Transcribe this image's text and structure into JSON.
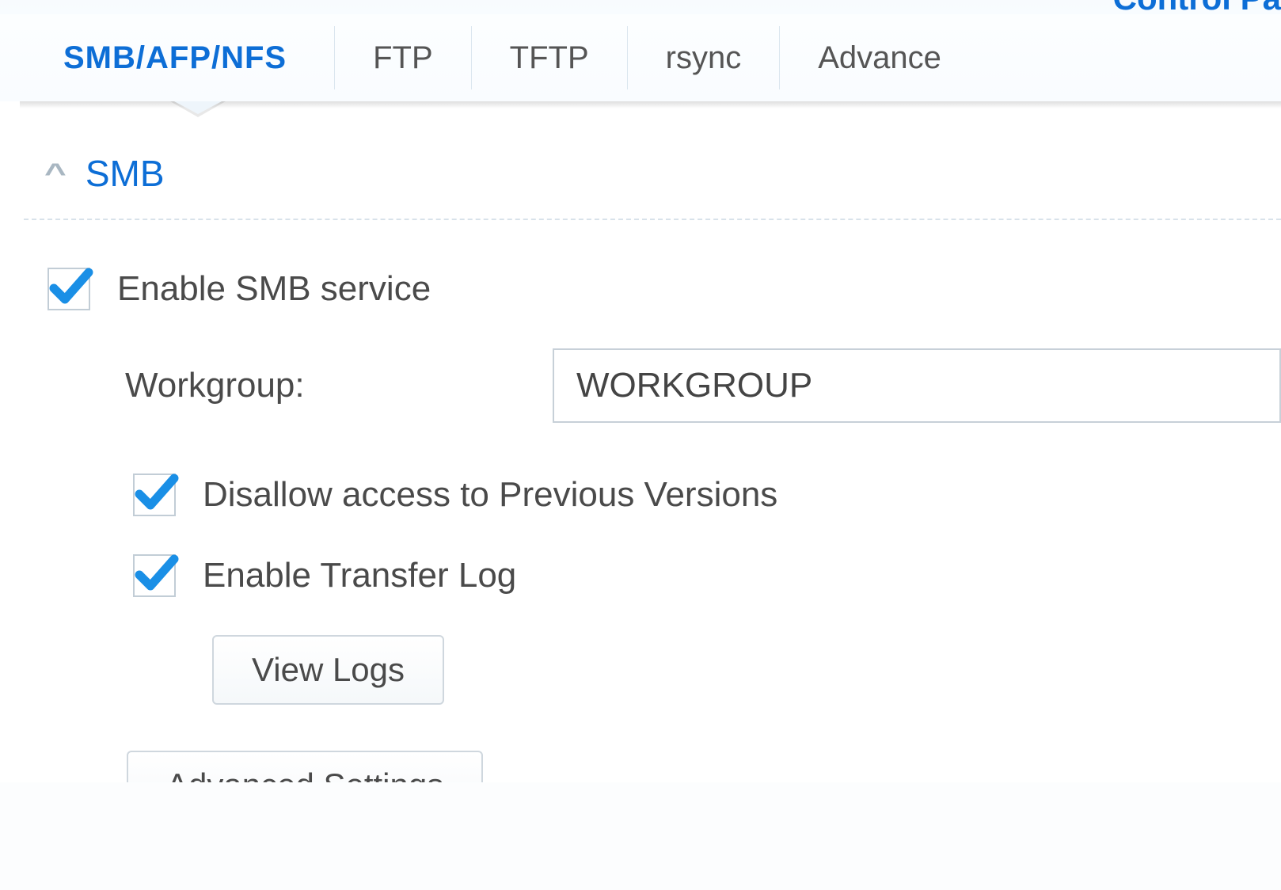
{
  "header": {
    "title_fragment": "Control Pa"
  },
  "tabs": [
    {
      "label": "SMB/AFP/NFS",
      "active": true
    },
    {
      "label": "FTP",
      "active": false
    },
    {
      "label": "TFTP",
      "active": false
    },
    {
      "label": "rsync",
      "active": false
    },
    {
      "label": "Advance",
      "active": false
    }
  ],
  "section": {
    "title": "SMB"
  },
  "smb": {
    "enable_label": "Enable SMB service",
    "enable_checked": true,
    "workgroup_label": "Workgroup:",
    "workgroup_value": "WORKGROUP",
    "disallow_prev_label": "Disallow access to Previous Versions",
    "disallow_prev_checked": true,
    "transfer_log_label": "Enable Transfer Log",
    "transfer_log_checked": true,
    "view_logs_label": "View Logs",
    "advanced_settings_label": "Advanced Settings"
  },
  "colors": {
    "accent": "#0d6ed6",
    "text": "#4a4a4a",
    "border": "#c7d0d8"
  }
}
